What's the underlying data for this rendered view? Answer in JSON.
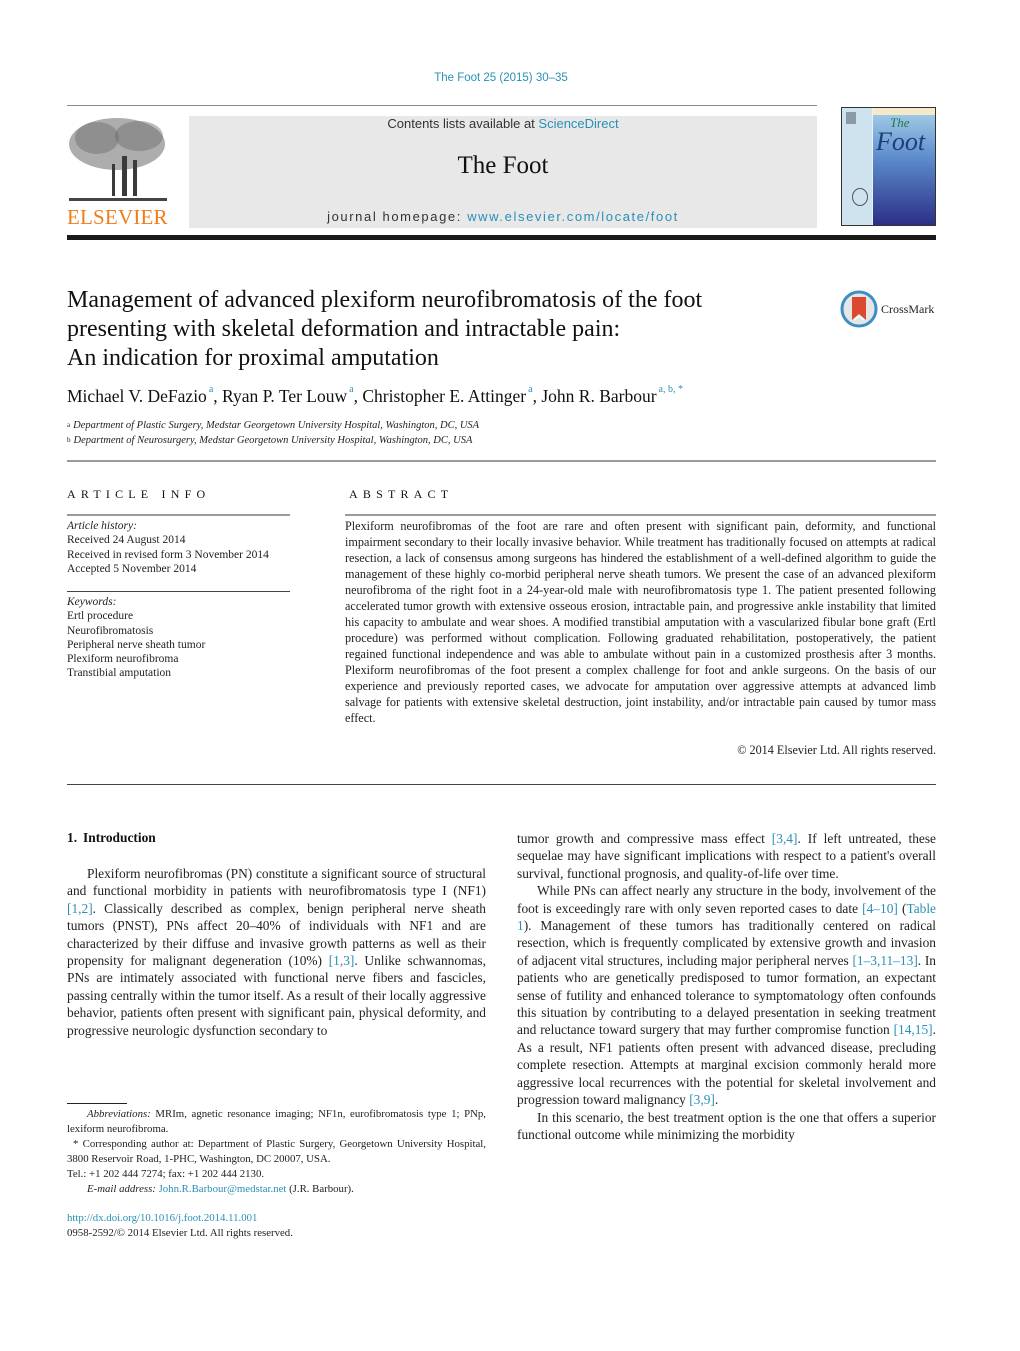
{
  "header": {
    "journal_ref": "The Foot 25 (2015) 30–35",
    "publisher_logo_text": "ELSEVIER",
    "contents_prefix": "Contents lists available at ",
    "contents_link": "ScienceDirect",
    "journal_title": "The Foot",
    "homepage_prefix": "journal homepage: ",
    "homepage_link": "www.elsevier.com/locate/foot",
    "cover_title": "Foot",
    "cover_title_small": "The"
  },
  "article": {
    "title_lines": [
      "Management of advanced plexiform neurofibromatosis of the foot",
      "presenting with skeletal deformation and intractable pain:",
      "An indication for proximal amputation"
    ],
    "crossmark_label": "CrossMark",
    "authors": [
      {
        "name": "Michael V. DeFazio",
        "sup": "a"
      },
      {
        "name": "Ryan P. Ter Louw",
        "sup": "a"
      },
      {
        "name": "Christopher E. Attinger",
        "sup": "a"
      },
      {
        "name": "John R. Barbour",
        "sup": "a, b, *"
      }
    ],
    "author_separator": ", ",
    "affiliations": [
      {
        "mark": "a",
        "text": "Department of Plastic Surgery, Medstar Georgetown University Hospital, Washington, DC, USA"
      },
      {
        "mark": "b",
        "text": "Department of Neurosurgery, Medstar Georgetown University Hospital, Washington, DC, USA"
      }
    ]
  },
  "article_info": {
    "heading": "ARTICLE INFO",
    "history_label": "Article history:",
    "history": [
      "Received 24 August 2014",
      "Received in revised form 3 November 2014",
      "Accepted 5 November 2014"
    ],
    "keywords_label": "Keywords:",
    "keywords": [
      "Ertl procedure",
      "Neurofibromatosis",
      "Peripheral nerve sheath tumor",
      "Plexiform neurofibroma",
      "Transtibial amputation"
    ]
  },
  "abstract": {
    "heading": "ABSTRACT",
    "text": "Plexiform neurofibromas of the foot are rare and often present with significant pain, deformity, and functional impairment secondary to their locally invasive behavior. While treatment has traditionally focused on attempts at radical resection, a lack of consensus among surgeons has hindered the establishment of a well-defined algorithm to guide the management of these highly co-morbid peripheral nerve sheath tumors. We present the case of an advanced plexiform neurofibroma of the right foot in a 24-year-old male with neurofibromatosis type 1. The patient presented following accelerated tumor growth with extensive osseous erosion, intractable pain, and progressive ankle instability that limited his capacity to ambulate and wear shoes. A modified transtibial amputation with a vascularized fibular bone graft (Ertl procedure) was performed without complication. Following graduated rehabilitation, postoperatively, the patient regained functional independence and was able to ambulate without pain in a customized prosthesis after 3 months. Plexiform neurofibromas of the foot present a complex challenge for foot and ankle surgeons. On the basis of our experience and previously reported cases, we advocate for amputation over aggressive attempts at advanced limb salvage for patients with extensive skeletal destruction, joint instability, and/or intractable pain caused by tumor mass effect.",
    "copyright": "© 2014 Elsevier Ltd. All rights reserved."
  },
  "body": {
    "section_number": "1.",
    "section_title": "Introduction",
    "left_paragraphs": [
      [
        {
          "t": "Plexiform neurofibromas (PN) constitute a significant source of structural and functional morbidity in patients with neurofibromatosis type I (NF1) "
        },
        {
          "ref": "[1,2]"
        },
        {
          "t": ". Classically described as complex, benign peripheral nerve sheath tumors (PNST), PNs affect 20–40% of individuals with NF1 and are characterized by their diffuse and invasive growth patterns as well as their propensity for malignant degeneration (10%) "
        },
        {
          "ref": "[1,3]"
        },
        {
          "t": ". Unlike schwannomas, PNs are intimately associated with functional nerve fibers and fascicles, passing centrally within the tumor itself. As a result of their locally aggressive behavior, patients often present with significant pain, physical deformity, and progressive neurologic dysfunction secondary to"
        }
      ]
    ],
    "right_paragraphs": [
      {
        "indent": false,
        "parts": [
          {
            "t": "tumor growth and compressive mass effect "
          },
          {
            "ref": "[3,4]"
          },
          {
            "t": ". If left untreated, these sequelae may have significant implications with respect to a patient's overall survival, functional prognosis, and quality-of-life over time."
          }
        ]
      },
      {
        "indent": true,
        "parts": [
          {
            "t": "While PNs can affect nearly any structure in the body, involvement of the foot is exceedingly rare with only seven reported cases to date "
          },
          {
            "ref": "[4–10]"
          },
          {
            "t": " ("
          },
          {
            "ref": "Table 1"
          },
          {
            "t": "). Management of these tumors has traditionally centered on radical resection, which is frequently complicated by extensive growth and invasion of adjacent vital structures, including major peripheral nerves "
          },
          {
            "ref": "[1–3,11–13]"
          },
          {
            "t": ". In patients who are genetically predisposed to tumor formation, an expectant sense of futility and enhanced tolerance to symptomatology often confounds this situation by contributing to a delayed presentation in seeking treatment and reluctance toward surgery that may further compromise function "
          },
          {
            "ref": "[14,15]"
          },
          {
            "t": ". As a result, NF1 patients often present with advanced disease, precluding complete resection. Attempts at marginal excision commonly herald more aggressive local recurrences with the potential for skeletal involvement and progression toward malignancy "
          },
          {
            "ref": "[3,9]"
          },
          {
            "t": "."
          }
        ]
      },
      {
        "indent": true,
        "parts": [
          {
            "t": "In this scenario, the best treatment option is the one that offers a superior functional outcome while minimizing the morbidity"
          }
        ]
      }
    ]
  },
  "footnotes": {
    "abbrev_label": "Abbreviations:",
    "abbrev_text": " MRIm, agnetic resonance imaging; NF1n, eurofibromatosis type 1; PNp, lexiform neurofibroma.",
    "corresponding": "* Corresponding author at: Department of Plastic Surgery, Georgetown University Hospital, 3800 Reservoir Road, 1-PHC, Washington, DC 20007, USA.",
    "tel": "Tel.: +1 202 444 7274; fax: +1 202 444 2130.",
    "email_label": "E-mail address:",
    "email": "John.R.Barbour@medstar.net",
    "email_suffix": " (J.R. Barbour).",
    "doi": "http://dx.doi.org/10.1016/j.foot.2014.11.001",
    "issn": "0958-2592/© 2014 Elsevier Ltd. All rights reserved."
  },
  "colors": {
    "link": "#2a8fb8",
    "elsevier_orange": "#f07d1a",
    "banner_bg": "#e8e8e8"
  }
}
